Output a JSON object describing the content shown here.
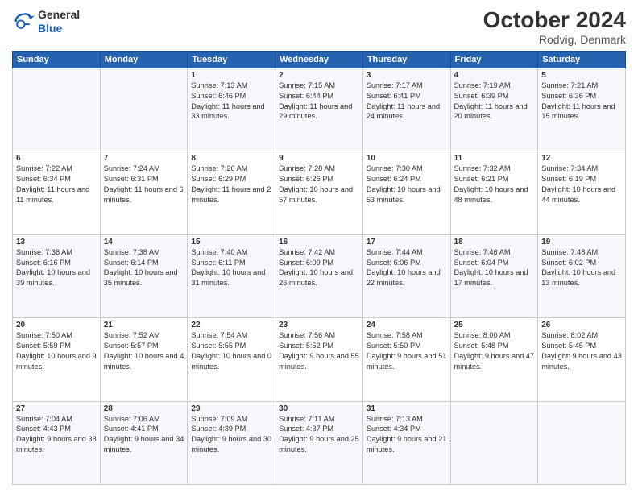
{
  "header": {
    "logo_line1": "General",
    "logo_line2": "Blue",
    "month_title": "October 2024",
    "location": "Rodvig, Denmark"
  },
  "columns": [
    "Sunday",
    "Monday",
    "Tuesday",
    "Wednesday",
    "Thursday",
    "Friday",
    "Saturday"
  ],
  "weeks": [
    [
      {
        "num": "",
        "sunrise": "",
        "sunset": "",
        "daylight": ""
      },
      {
        "num": "",
        "sunrise": "",
        "sunset": "",
        "daylight": ""
      },
      {
        "num": "1",
        "sunrise": "Sunrise: 7:13 AM",
        "sunset": "Sunset: 6:46 PM",
        "daylight": "Daylight: 11 hours and 33 minutes."
      },
      {
        "num": "2",
        "sunrise": "Sunrise: 7:15 AM",
        "sunset": "Sunset: 6:44 PM",
        "daylight": "Daylight: 11 hours and 29 minutes."
      },
      {
        "num": "3",
        "sunrise": "Sunrise: 7:17 AM",
        "sunset": "Sunset: 6:41 PM",
        "daylight": "Daylight: 11 hours and 24 minutes."
      },
      {
        "num": "4",
        "sunrise": "Sunrise: 7:19 AM",
        "sunset": "Sunset: 6:39 PM",
        "daylight": "Daylight: 11 hours and 20 minutes."
      },
      {
        "num": "5",
        "sunrise": "Sunrise: 7:21 AM",
        "sunset": "Sunset: 6:36 PM",
        "daylight": "Daylight: 11 hours and 15 minutes."
      }
    ],
    [
      {
        "num": "6",
        "sunrise": "Sunrise: 7:22 AM",
        "sunset": "Sunset: 6:34 PM",
        "daylight": "Daylight: 11 hours and 11 minutes."
      },
      {
        "num": "7",
        "sunrise": "Sunrise: 7:24 AM",
        "sunset": "Sunset: 6:31 PM",
        "daylight": "Daylight: 11 hours and 6 minutes."
      },
      {
        "num": "8",
        "sunrise": "Sunrise: 7:26 AM",
        "sunset": "Sunset: 6:29 PM",
        "daylight": "Daylight: 11 hours and 2 minutes."
      },
      {
        "num": "9",
        "sunrise": "Sunrise: 7:28 AM",
        "sunset": "Sunset: 6:26 PM",
        "daylight": "Daylight: 10 hours and 57 minutes."
      },
      {
        "num": "10",
        "sunrise": "Sunrise: 7:30 AM",
        "sunset": "Sunset: 6:24 PM",
        "daylight": "Daylight: 10 hours and 53 minutes."
      },
      {
        "num": "11",
        "sunrise": "Sunrise: 7:32 AM",
        "sunset": "Sunset: 6:21 PM",
        "daylight": "Daylight: 10 hours and 48 minutes."
      },
      {
        "num": "12",
        "sunrise": "Sunrise: 7:34 AM",
        "sunset": "Sunset: 6:19 PM",
        "daylight": "Daylight: 10 hours and 44 minutes."
      }
    ],
    [
      {
        "num": "13",
        "sunrise": "Sunrise: 7:36 AM",
        "sunset": "Sunset: 6:16 PM",
        "daylight": "Daylight: 10 hours and 39 minutes."
      },
      {
        "num": "14",
        "sunrise": "Sunrise: 7:38 AM",
        "sunset": "Sunset: 6:14 PM",
        "daylight": "Daylight: 10 hours and 35 minutes."
      },
      {
        "num": "15",
        "sunrise": "Sunrise: 7:40 AM",
        "sunset": "Sunset: 6:11 PM",
        "daylight": "Daylight: 10 hours and 31 minutes."
      },
      {
        "num": "16",
        "sunrise": "Sunrise: 7:42 AM",
        "sunset": "Sunset: 6:09 PM",
        "daylight": "Daylight: 10 hours and 26 minutes."
      },
      {
        "num": "17",
        "sunrise": "Sunrise: 7:44 AM",
        "sunset": "Sunset: 6:06 PM",
        "daylight": "Daylight: 10 hours and 22 minutes."
      },
      {
        "num": "18",
        "sunrise": "Sunrise: 7:46 AM",
        "sunset": "Sunset: 6:04 PM",
        "daylight": "Daylight: 10 hours and 17 minutes."
      },
      {
        "num": "19",
        "sunrise": "Sunrise: 7:48 AM",
        "sunset": "Sunset: 6:02 PM",
        "daylight": "Daylight: 10 hours and 13 minutes."
      }
    ],
    [
      {
        "num": "20",
        "sunrise": "Sunrise: 7:50 AM",
        "sunset": "Sunset: 5:59 PM",
        "daylight": "Daylight: 10 hours and 9 minutes."
      },
      {
        "num": "21",
        "sunrise": "Sunrise: 7:52 AM",
        "sunset": "Sunset: 5:57 PM",
        "daylight": "Daylight: 10 hours and 4 minutes."
      },
      {
        "num": "22",
        "sunrise": "Sunrise: 7:54 AM",
        "sunset": "Sunset: 5:55 PM",
        "daylight": "Daylight: 10 hours and 0 minutes."
      },
      {
        "num": "23",
        "sunrise": "Sunrise: 7:56 AM",
        "sunset": "Sunset: 5:52 PM",
        "daylight": "Daylight: 9 hours and 55 minutes."
      },
      {
        "num": "24",
        "sunrise": "Sunrise: 7:58 AM",
        "sunset": "Sunset: 5:50 PM",
        "daylight": "Daylight: 9 hours and 51 minutes."
      },
      {
        "num": "25",
        "sunrise": "Sunrise: 8:00 AM",
        "sunset": "Sunset: 5:48 PM",
        "daylight": "Daylight: 9 hours and 47 minutes."
      },
      {
        "num": "26",
        "sunrise": "Sunrise: 8:02 AM",
        "sunset": "Sunset: 5:45 PM",
        "daylight": "Daylight: 9 hours and 43 minutes."
      }
    ],
    [
      {
        "num": "27",
        "sunrise": "Sunrise: 7:04 AM",
        "sunset": "Sunset: 4:43 PM",
        "daylight": "Daylight: 9 hours and 38 minutes."
      },
      {
        "num": "28",
        "sunrise": "Sunrise: 7:06 AM",
        "sunset": "Sunset: 4:41 PM",
        "daylight": "Daylight: 9 hours and 34 minutes."
      },
      {
        "num": "29",
        "sunrise": "Sunrise: 7:09 AM",
        "sunset": "Sunset: 4:39 PM",
        "daylight": "Daylight: 9 hours and 30 minutes."
      },
      {
        "num": "30",
        "sunrise": "Sunrise: 7:11 AM",
        "sunset": "Sunset: 4:37 PM",
        "daylight": "Daylight: 9 hours and 25 minutes."
      },
      {
        "num": "31",
        "sunrise": "Sunrise: 7:13 AM",
        "sunset": "Sunset: 4:34 PM",
        "daylight": "Daylight: 9 hours and 21 minutes."
      },
      {
        "num": "",
        "sunrise": "",
        "sunset": "",
        "daylight": ""
      },
      {
        "num": "",
        "sunrise": "",
        "sunset": "",
        "daylight": ""
      }
    ]
  ]
}
